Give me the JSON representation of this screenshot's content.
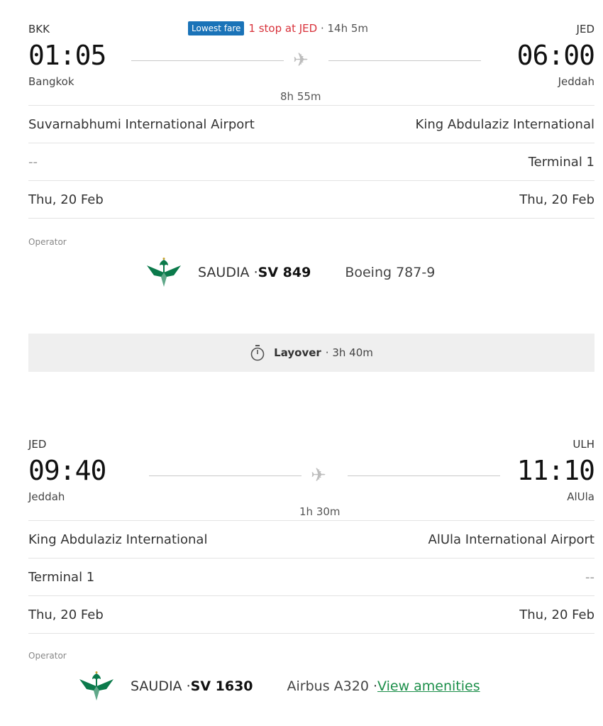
{
  "segment1": {
    "from_code": "BKK",
    "to_code": "JED",
    "badge": "Lowest fare",
    "stops": "1 stop at JED",
    "total_duration": " · 14h 5m",
    "depart_time": "01:05",
    "arrive_time": "06:00",
    "from_city": "Bangkok",
    "to_city": "Jeddah",
    "duration": "8h 55m",
    "from_airport": "Suvarnabhumi International Airport",
    "to_airport": "King Abdulaziz International",
    "from_terminal": "--",
    "to_terminal": "Terminal 1",
    "depart_date": "Thu, 20 Feb",
    "arrive_date": "Thu, 20 Feb",
    "operator_label": "Operator",
    "airline": "SAUDIA · ",
    "flight_number": "SV 849",
    "aircraft": "Boeing 787-9"
  },
  "layover": {
    "icon": "stopwatch-icon",
    "label": "Layover",
    "duration": "· 3h 40m"
  },
  "segment2": {
    "from_code": "JED",
    "to_code": "ULH",
    "depart_time": "09:40",
    "arrive_time": "11:10",
    "from_city": "Jeddah",
    "to_city": "AlUla",
    "duration": "1h 30m",
    "from_airport": "King Abdulaziz International",
    "to_airport": "AlUla International Airport",
    "from_terminal": "Terminal 1",
    "to_terminal": "--",
    "depart_date": "Thu, 20 Feb",
    "arrive_date": "Thu, 20 Feb",
    "operator_label": "Operator",
    "airline": "SAUDIA · ",
    "flight_number": "SV 1630",
    "aircraft": "Airbus A320 · ",
    "amenities_link": "View amenities"
  },
  "colors": {
    "badge": "#1a73b8",
    "stops": "#d8323b",
    "saudia_green": "#0b7a4b",
    "link": "#1c8f4a"
  }
}
